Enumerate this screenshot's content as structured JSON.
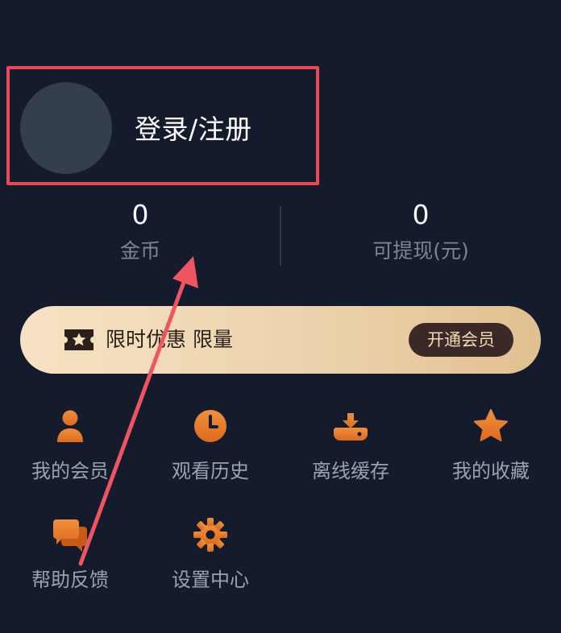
{
  "profile": {
    "login_label": "登录/注册"
  },
  "stats": [
    {
      "value": "0",
      "label": "金币"
    },
    {
      "value": "0",
      "label": "可提现(元)"
    }
  ],
  "vip_banner": {
    "text": "限时优惠 限量",
    "button_label": "开通会员"
  },
  "grid": [
    {
      "label": "我的会员",
      "icon": "user-icon"
    },
    {
      "label": "观看历史",
      "icon": "clock-icon"
    },
    {
      "label": "离线缓存",
      "icon": "download-icon"
    },
    {
      "label": "我的收藏",
      "icon": "star-icon"
    },
    {
      "label": "帮助反馈",
      "icon": "chat-icon"
    },
    {
      "label": "设置中心",
      "icon": "gear-icon"
    }
  ],
  "colors": {
    "background": "#141b2d",
    "accent_orange": "#e8772a",
    "highlight_red": "#e64a55",
    "vip_gold": "#ecd3ad",
    "vip_button": "#3a2926"
  }
}
